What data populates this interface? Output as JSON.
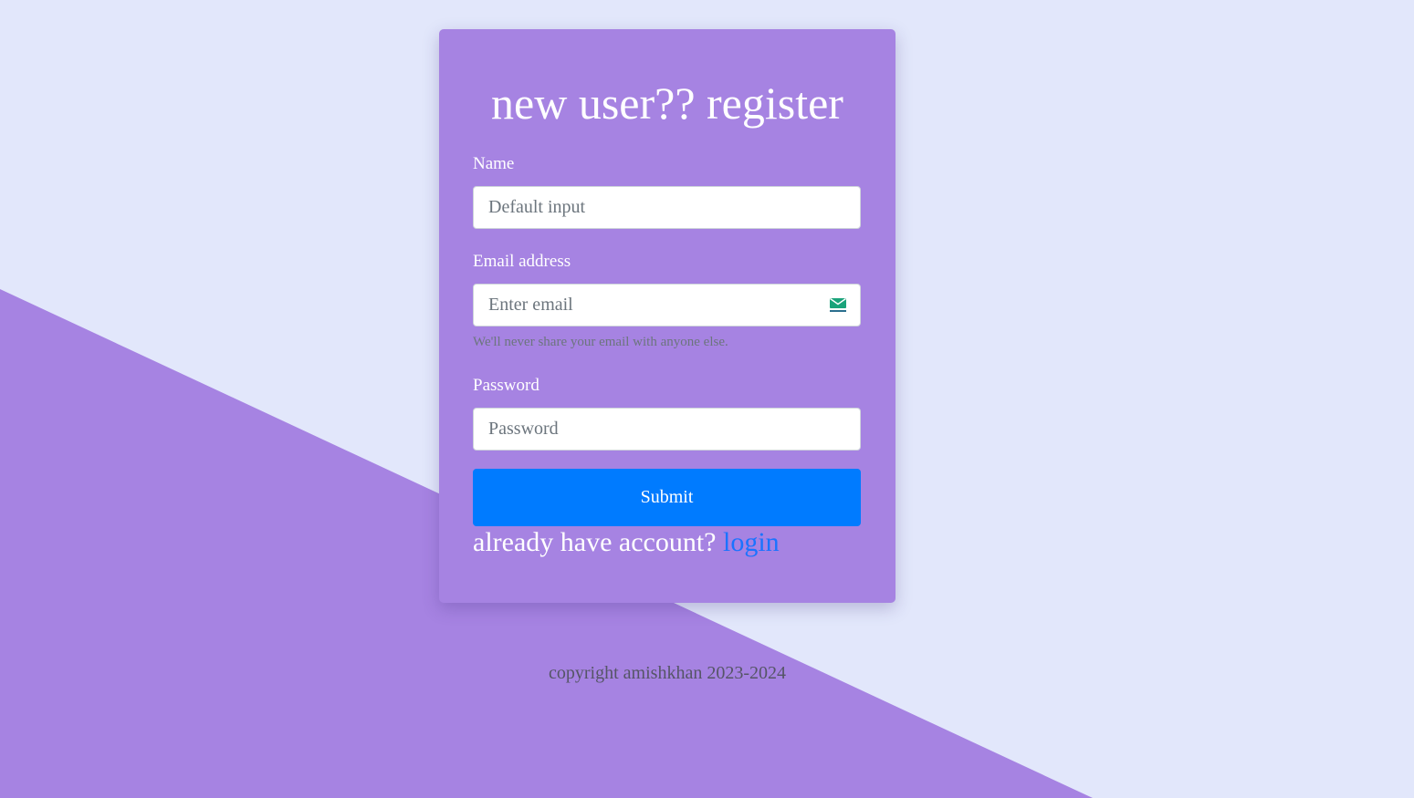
{
  "form": {
    "title": "new user?? register",
    "name_label": "Name",
    "name_placeholder": "Default input",
    "email_label": "Email address",
    "email_placeholder": "Enter email",
    "email_help": "We'll never share your email with anyone else.",
    "email_icon": "tempmail-envelope-icon",
    "password_label": "Password",
    "password_placeholder": "Password",
    "submit_label": "Submit",
    "already_text": "already have account?",
    "login_link": "login"
  },
  "footer": {
    "copyright": "copyright amishkhan 2023-2024"
  },
  "colors": {
    "page_background": "#e2e7fb",
    "accent_purple": "#a683e2",
    "submit_blue": "#007bff",
    "link_blue": "#1a73ff"
  }
}
